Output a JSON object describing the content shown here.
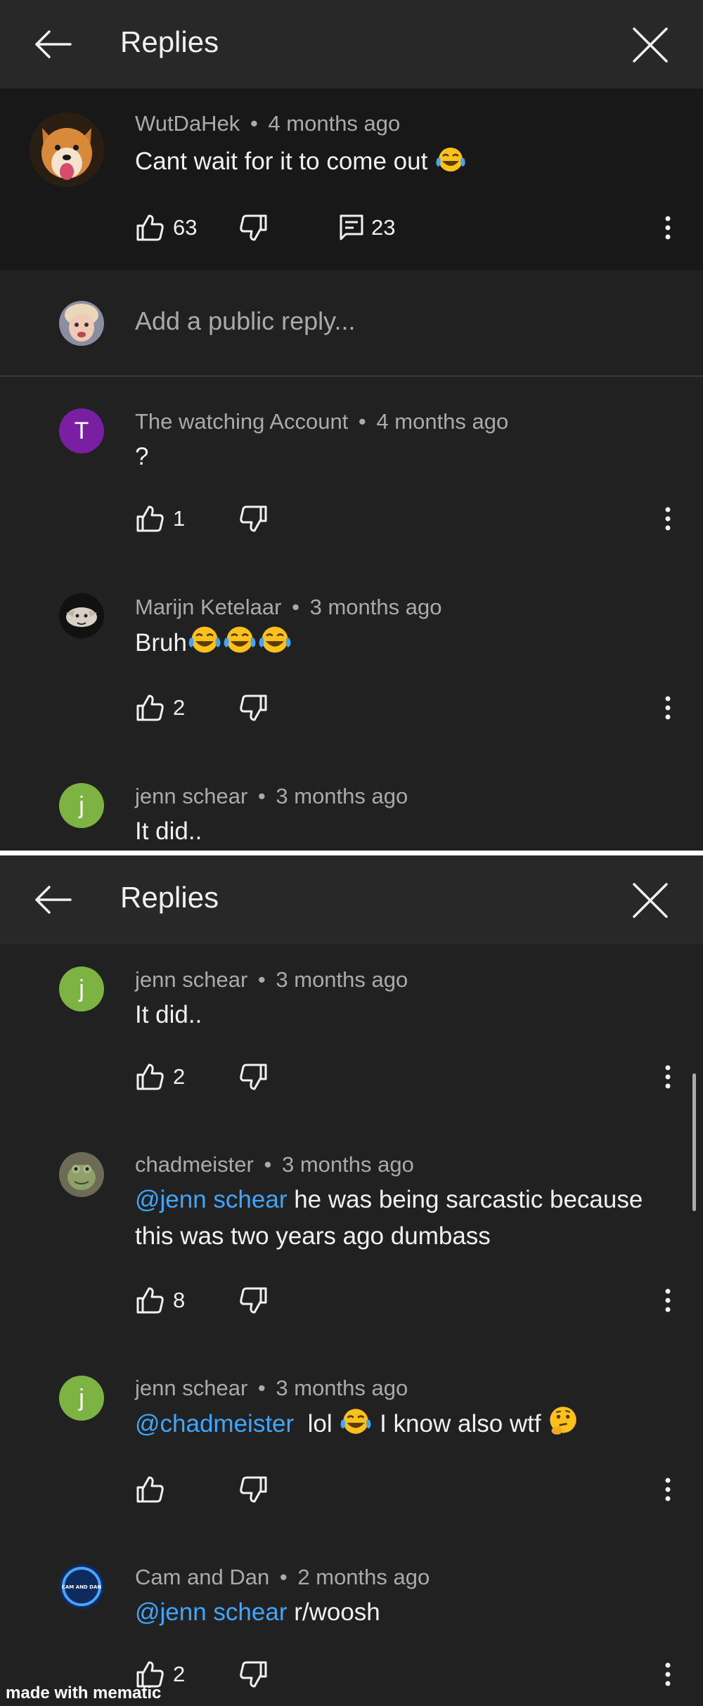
{
  "header": {
    "title": "Replies"
  },
  "parent": {
    "author": "WutDaHek",
    "age": "4 months ago",
    "text": "Cant wait for it to come out",
    "likes": "63",
    "replies": "23"
  },
  "reply_input": {
    "placeholder": "Add a public reply..."
  },
  "top_replies": [
    {
      "author": "The watching Account",
      "age": "4 months ago",
      "text": "?",
      "likes": "1",
      "avatar_letter": "T",
      "avatar_color": "#7b1fa2"
    },
    {
      "author": "Marijn Ketelaar",
      "age": "3 months ago",
      "text": "Bruh",
      "likes": "2"
    },
    {
      "author": "jenn schear",
      "age": "3 months ago",
      "text": "It did..",
      "avatar_letter": "j",
      "avatar_color": "#7cb342"
    }
  ],
  "bottom_replies": [
    {
      "author": "jenn schear",
      "age": "3 months ago",
      "text": "It did..",
      "likes": "2",
      "avatar_letter": "j",
      "avatar_color": "#7cb342"
    },
    {
      "author": "chadmeister",
      "age": "3 months ago",
      "mention": "@jenn schear",
      "text": " he was being sarcastic because this was two years ago dumbass",
      "likes": "8"
    },
    {
      "author": "jenn schear",
      "age": "3 months ago",
      "mention": "@chadmeister",
      "text_a": "  lol ",
      "text_b": " I know also wtf ",
      "avatar_letter": "j",
      "avatar_color": "#7cb342"
    },
    {
      "author": "Cam and Dan",
      "age": "2 months ago",
      "mention": "@jenn schear",
      "text": " r/woosh",
      "likes": "2",
      "avatar_label": "CAM AND DAN"
    }
  ],
  "meta_separator": "•",
  "watermark": "made with mematic",
  "colors": {
    "background": "#212121",
    "header": "#282828",
    "parent_bg": "#181818",
    "mention": "#3ea6ff",
    "muted": "#aaaaaa"
  },
  "icons": [
    "back-arrow-icon",
    "close-icon",
    "thumbs-up-icon",
    "thumbs-down-icon",
    "reply-comment-icon",
    "more-vert-icon",
    "laughing-emoji-icon",
    "thinking-emoji-icon"
  ]
}
